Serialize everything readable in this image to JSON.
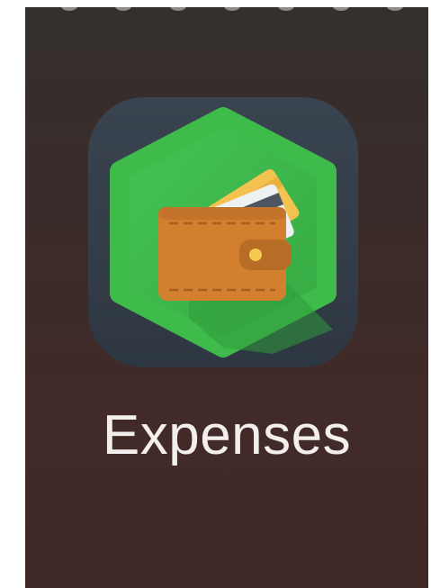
{
  "app": {
    "label": "Expenses",
    "icon": "wallet-icon"
  },
  "colors": {
    "icon_background": "#36404a",
    "hexagon_green": "#3db74a",
    "wallet_brown": "#d4802f",
    "card_yellow": "#f2c04f"
  }
}
